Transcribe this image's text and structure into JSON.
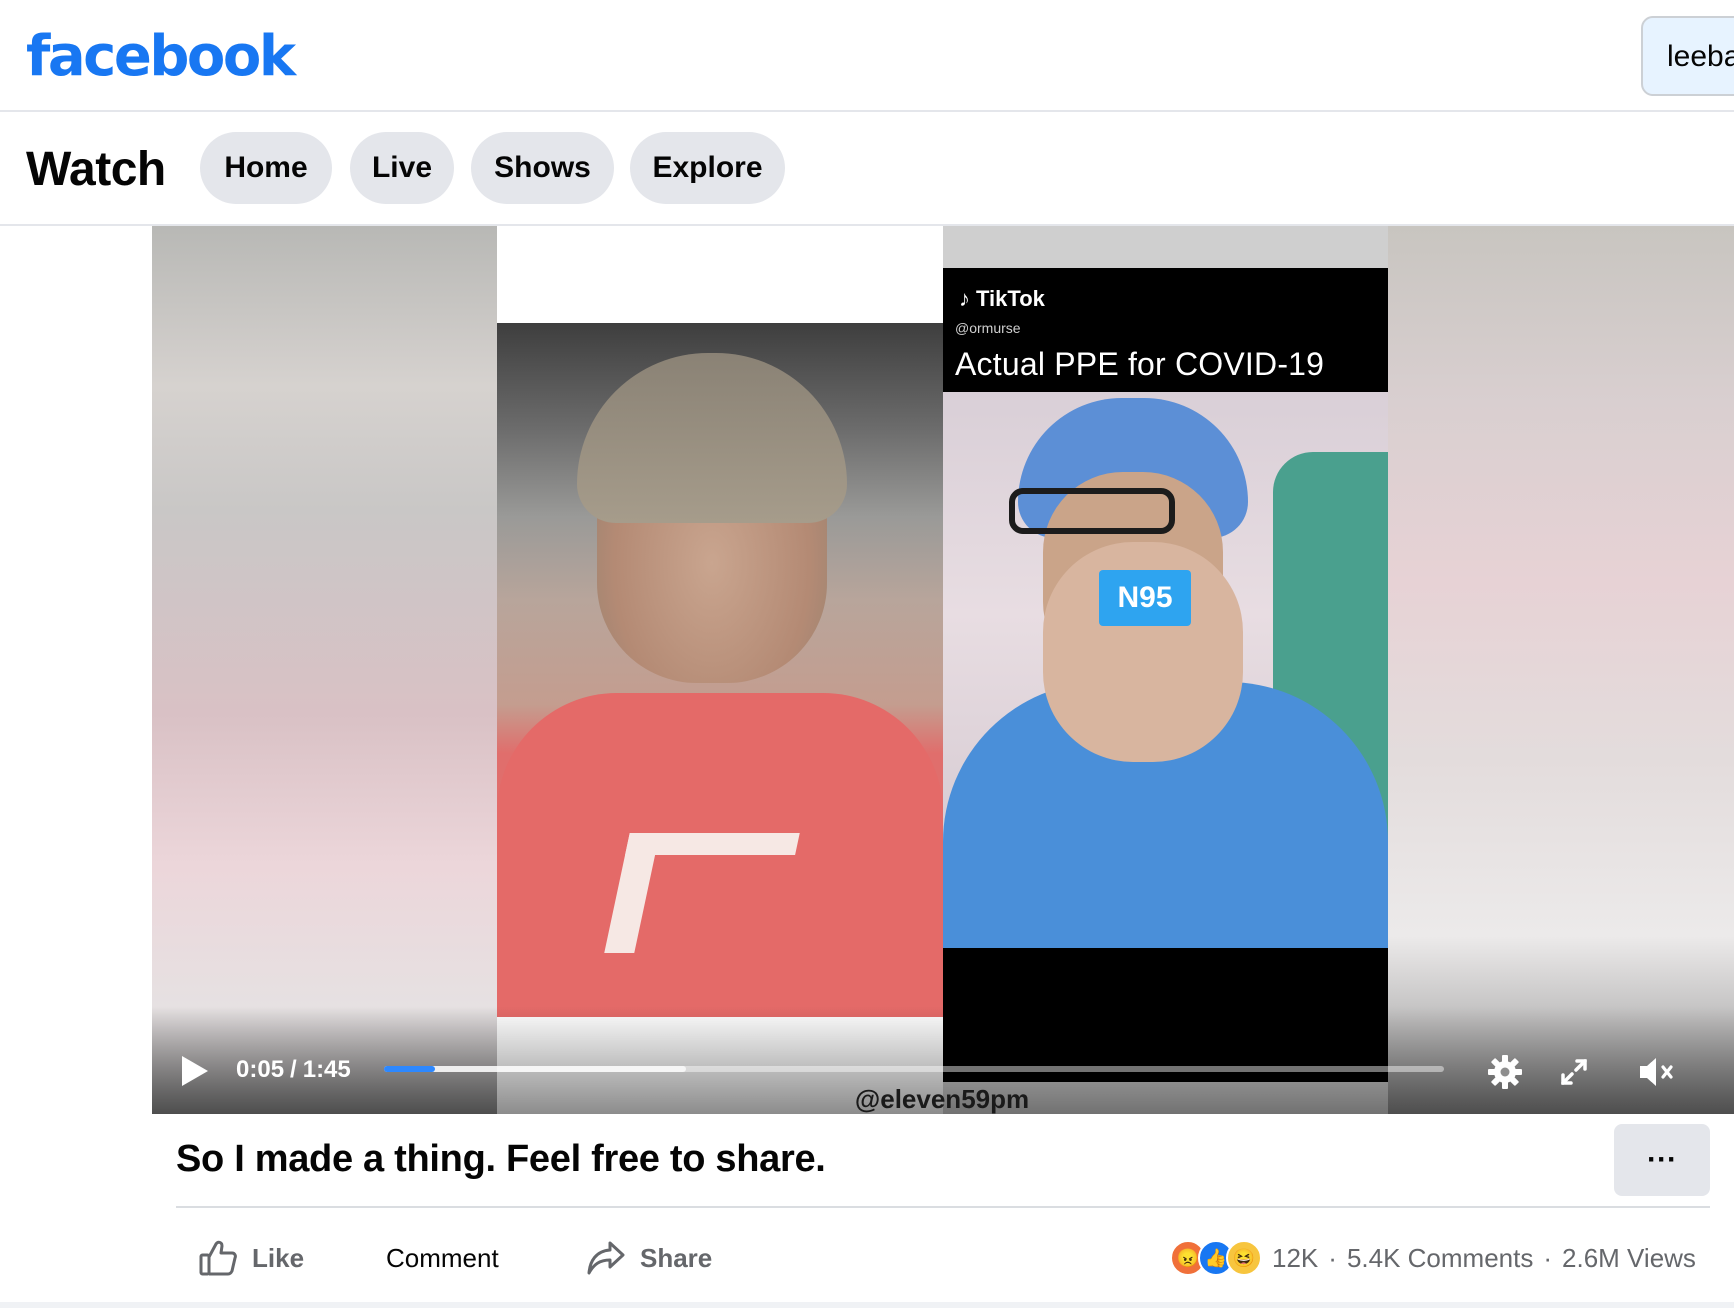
{
  "header": {
    "logo_text": "facebook",
    "account_label": "leeba",
    "brand_color": "#1877f2"
  },
  "watch": {
    "title": "Watch",
    "tabs": [
      {
        "label": "Home"
      },
      {
        "label": "Live"
      },
      {
        "label": "Shows"
      },
      {
        "label": "Explore"
      }
    ]
  },
  "video": {
    "tiktok_brand": "TikTok",
    "tiktok_handle": "@ormurse",
    "caption": "Actual PPE for COVID-19",
    "mask_label": "N95",
    "watermark": "@eleven59pm",
    "current_time": "0:05",
    "separator": "/",
    "duration": "1:45",
    "progress_played_fraction": 0.048,
    "progress_buffered_fraction": 0.285,
    "controls": [
      "play-icon",
      "settings-gear-icon",
      "fullscreen-icon",
      "muted-speaker-icon"
    ]
  },
  "post": {
    "title": "So I made a thing. Feel free to share.",
    "more_label": "···",
    "actions": {
      "like": "Like",
      "comment": "Comment",
      "share": "Share"
    },
    "reactions": [
      "angry",
      "like",
      "haha"
    ],
    "reaction_count": "12K",
    "dot": "·",
    "comments": "5.4K Comments",
    "views": "2.6M Views"
  }
}
